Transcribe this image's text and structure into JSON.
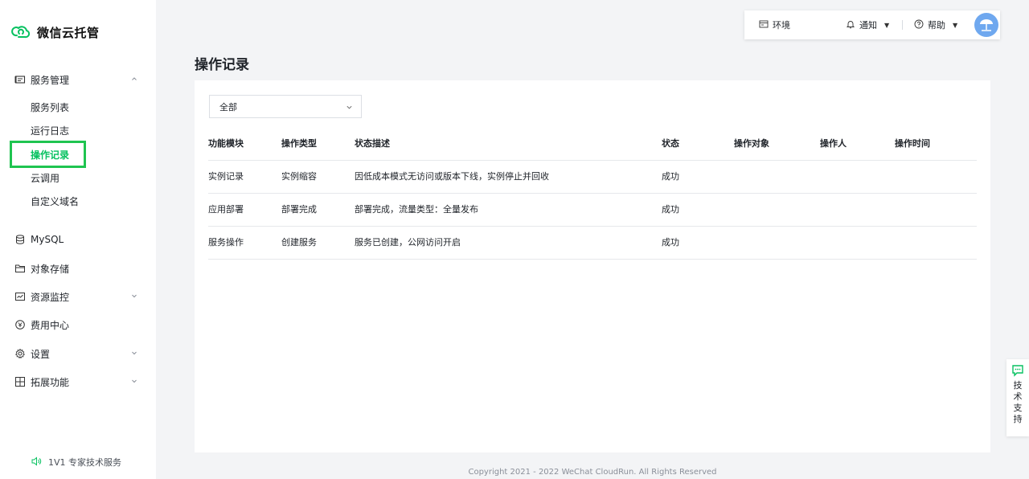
{
  "app": {
    "title": "微信云托管"
  },
  "sidebar": {
    "groups": [
      {
        "label": "服务管理",
        "icon": "service-icon",
        "expanded": true,
        "items": [
          {
            "label": "服务列表"
          },
          {
            "label": "运行日志"
          },
          {
            "label": "操作记录",
            "active": true
          },
          {
            "label": "云调用"
          },
          {
            "label": "自定义域名"
          }
        ]
      },
      {
        "label": "MySQL",
        "icon": "database-icon"
      },
      {
        "label": "对象存储",
        "icon": "folder-icon"
      },
      {
        "label": "资源监控",
        "icon": "monitor-icon",
        "expandable": true
      },
      {
        "label": "费用中心",
        "icon": "yen-icon"
      },
      {
        "label": "设置",
        "icon": "gear-icon",
        "expandable": true
      },
      {
        "label": "拓展功能",
        "icon": "extension-icon",
        "expandable": true
      }
    ],
    "footer": "1V1 专家技术服务"
  },
  "topbar": {
    "env_label": "环境",
    "notify_label": "通知",
    "help_label": "帮助"
  },
  "main": {
    "title": "操作记录",
    "filter": {
      "selected": "全部"
    },
    "table": {
      "columns": [
        "功能模块",
        "操作类型",
        "状态描述",
        "状态",
        "操作对象",
        "操作人",
        "操作时间"
      ],
      "rows": [
        {
          "module": "实例记录",
          "type": "实例缩容",
          "desc": "因低成本模式无访问或版本下线，实例停止并回收",
          "status": "成功",
          "target": "",
          "operator": "",
          "time": ""
        },
        {
          "module": "应用部署",
          "type": "部署完成",
          "desc": "部署完成，流量类型：全量发布",
          "status": "成功",
          "target": "",
          "operator": "",
          "time": ""
        },
        {
          "module": "服务操作",
          "type": "创建服务",
          "desc": "服务已创建，公网访问开启",
          "status": "成功",
          "target": "",
          "operator": "",
          "time": ""
        }
      ]
    }
  },
  "footer": {
    "copyright": "Copyright 2021 - 2022 WeChat CloudRun. All Rights Reserved"
  },
  "support": {
    "label": "技术支持"
  },
  "colors": {
    "brand": "#07c160",
    "highlight_box": "#1fc450",
    "avatar": "#6fa8ef"
  }
}
